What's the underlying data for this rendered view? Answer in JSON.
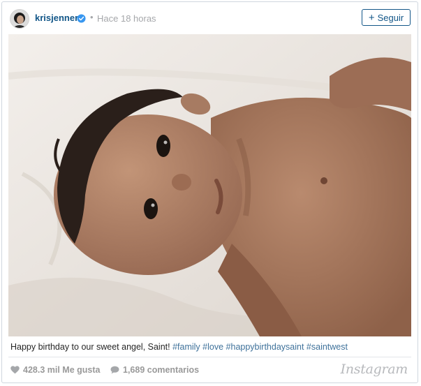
{
  "post": {
    "username": "krisjenner",
    "dot": "•",
    "timestamp": "Hace 18 horas",
    "follow_label": "Seguir",
    "follow_plus": "+",
    "caption_text": "Happy birthday to our sweet angel, Saint!",
    "hashtags": [
      "#family",
      "#love",
      "#happybirthdaysaint",
      "#saintwest"
    ],
    "likes": "428.3 mil Me gusta",
    "comments": "1,689 comentarios",
    "brand": "Instagram"
  },
  "colors": {
    "link_blue": "#125688",
    "hashtag_blue": "#3f729b",
    "verified_blue": "#3897f0",
    "muted_gray": "#a5a7aa"
  },
  "icons": {
    "verified": "verified-badge-icon",
    "like": "heart-icon",
    "comment": "speech-bubble-icon"
  }
}
